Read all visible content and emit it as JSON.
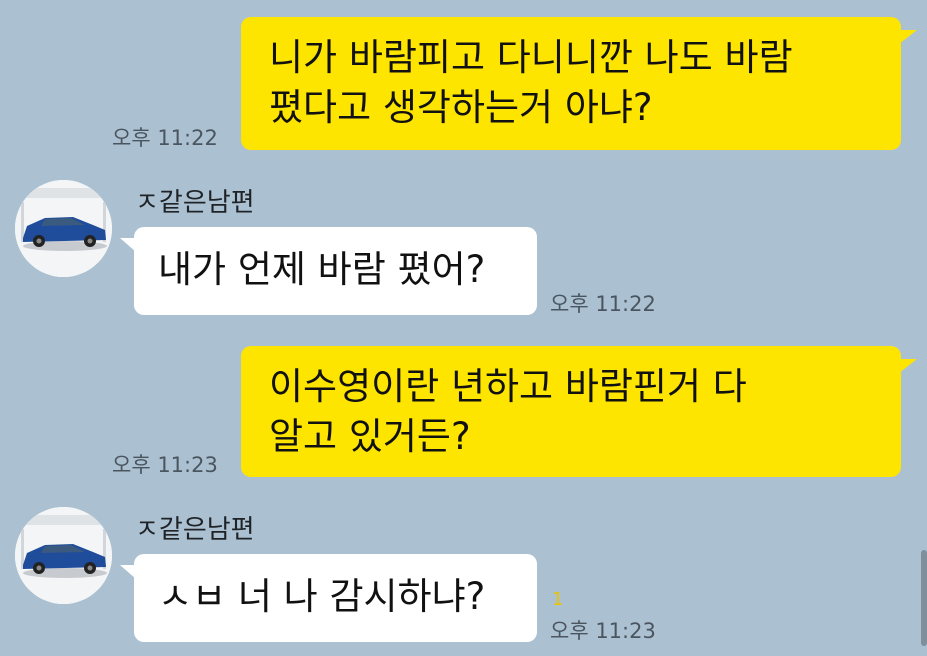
{
  "colors": {
    "background": "#abc1d1",
    "my_bubble": "#fee500",
    "their_bubble": "#ffffff"
  },
  "messages": [
    {
      "from": "me",
      "lines": [
        "니가 바람피고 다니니깐 나도 바람",
        "폈다고 생각하는거 아냐?"
      ],
      "time": "오후 11:22"
    },
    {
      "from": "other",
      "sender": "ㅈ같은남편",
      "avatar": "car-avatar-icon",
      "lines": [
        "내가 언제 바람 폈어?"
      ],
      "time": "오후 11:22"
    },
    {
      "from": "me",
      "lines": [
        "이수영이란 년하고 바람핀거 다",
        "알고 있거든?"
      ],
      "time": "오후 11:23"
    },
    {
      "from": "other",
      "sender": "ㅈ같은남편",
      "avatar": "car-avatar-icon",
      "lines": [
        "ㅅㅂ 너 나 감시하냐?"
      ],
      "time": "오후 11:23",
      "unread": "1"
    }
  ]
}
